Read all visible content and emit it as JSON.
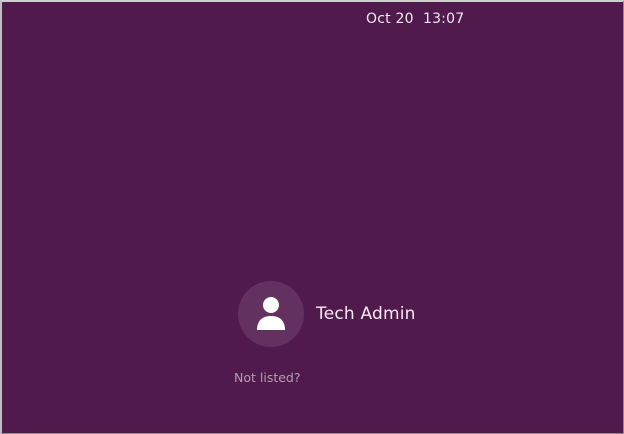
{
  "topbar": {
    "clock": "Oct 20  13:07"
  },
  "user_list": {
    "users": [
      {
        "name": "Tech Admin",
        "avatar_icon": "person-icon"
      }
    ],
    "not_listed_label": "Not listed?"
  },
  "colors": {
    "background": "#511a4d",
    "avatar_bg": "#623160",
    "text": "#f3ebf1",
    "muted_text": "#b49db2"
  }
}
